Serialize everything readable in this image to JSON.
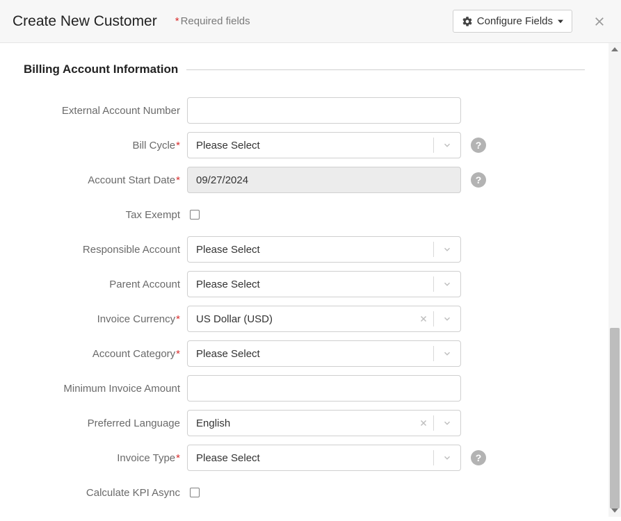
{
  "header": {
    "title": "Create New Customer",
    "required_hint": "Required fields",
    "asterisk": "*",
    "configure_label": "Configure Fields"
  },
  "section": {
    "title": "Billing Account Information"
  },
  "fields": {
    "external_account_number": {
      "label": "External Account Number",
      "value": ""
    },
    "bill_cycle": {
      "label": "Bill Cycle",
      "value": "Please Select"
    },
    "account_start_date": {
      "label": "Account Start Date",
      "value": "09/27/2024"
    },
    "tax_exempt": {
      "label": "Tax Exempt",
      "checked": false
    },
    "responsible_account": {
      "label": "Responsible Account",
      "value": "Please Select"
    },
    "parent_account": {
      "label": "Parent Account",
      "value": "Please Select"
    },
    "invoice_currency": {
      "label": "Invoice Currency",
      "value": "US Dollar (USD)"
    },
    "account_category": {
      "label": "Account Category",
      "value": "Please Select"
    },
    "minimum_invoice_amount": {
      "label": "Minimum Invoice Amount",
      "value": ""
    },
    "preferred_language": {
      "label": "Preferred Language",
      "value": "English"
    },
    "invoice_type": {
      "label": "Invoice Type",
      "value": "Please Select"
    },
    "calculate_kpi_async": {
      "label": "Calculate KPI Async",
      "checked": false
    }
  }
}
